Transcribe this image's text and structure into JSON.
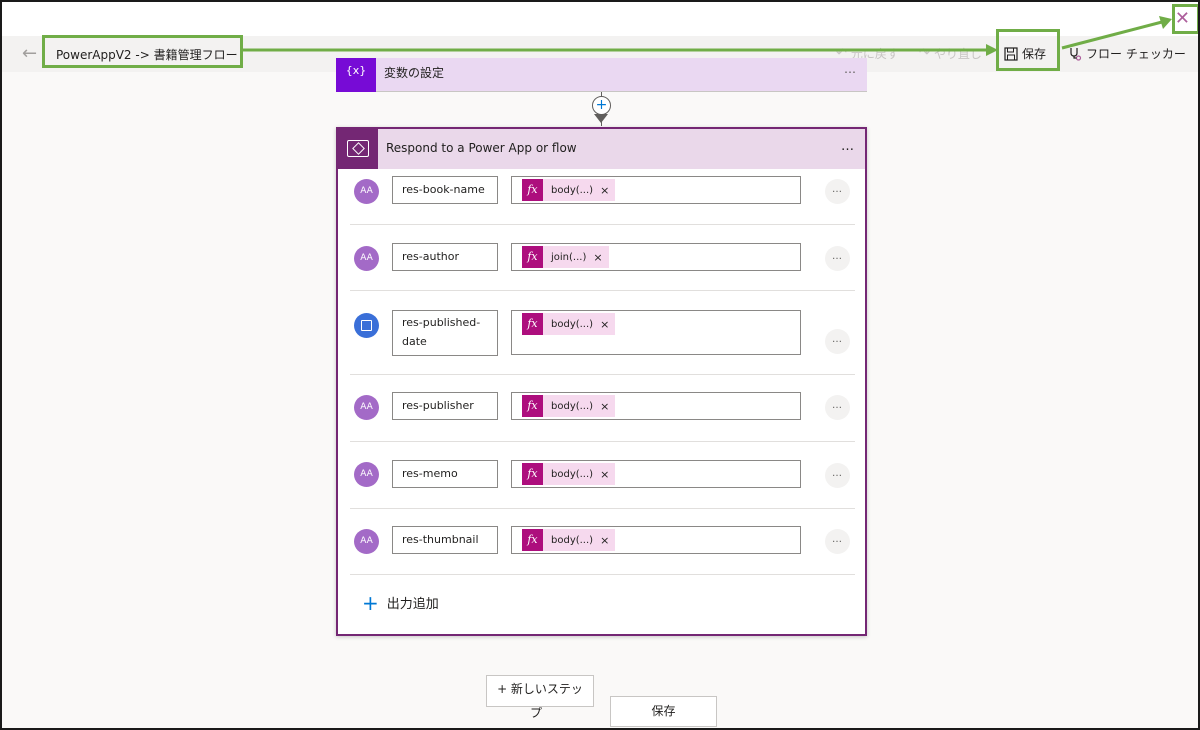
{
  "header": {
    "breadcrumb": "PowerAppV2 -> 書籍管理フロー",
    "undo_label": "元に戻す",
    "redo_label": "やり直し",
    "save_label": "保存",
    "checker_label": "フロー チェッカー"
  },
  "prev_action": {
    "title": "変数の設定",
    "icon_text": "{x}"
  },
  "card": {
    "title": "Respond to a Power App or flow",
    "add_output_label": "出力追加",
    "rows": [
      {
        "type": "text",
        "name": "res-book-name",
        "token": "body(...)"
      },
      {
        "type": "text",
        "name": "res-author",
        "token": "join(...)"
      },
      {
        "type": "date",
        "name": "res-published-date",
        "token": "body(...)"
      },
      {
        "type": "text",
        "name": "res-publisher",
        "token": "body(...)"
      },
      {
        "type": "text",
        "name": "res-memo",
        "token": "body(...)"
      },
      {
        "type": "text",
        "name": "res-thumbnail",
        "token": "body(...)"
      }
    ]
  },
  "footer": {
    "new_step_label": "+ 新しいステッ",
    "new_step_label_wrap": "プ",
    "save_label": "保存"
  },
  "icons": {
    "back": "arrow-left-icon",
    "undo": "undo-icon",
    "redo": "redo-icon",
    "save": "floppy-disk-icon",
    "checker": "stethoscope-icon",
    "close": "close-icon",
    "fx": "fx",
    "more": "…",
    "text_avatar": "AA",
    "remove_token": "×"
  },
  "colors": {
    "accent": "#742774",
    "highlight": "#70ad47",
    "token_bg": "#f6d9ee",
    "fx_bg": "#ad0e7d",
    "link_blue": "#0078d4"
  }
}
